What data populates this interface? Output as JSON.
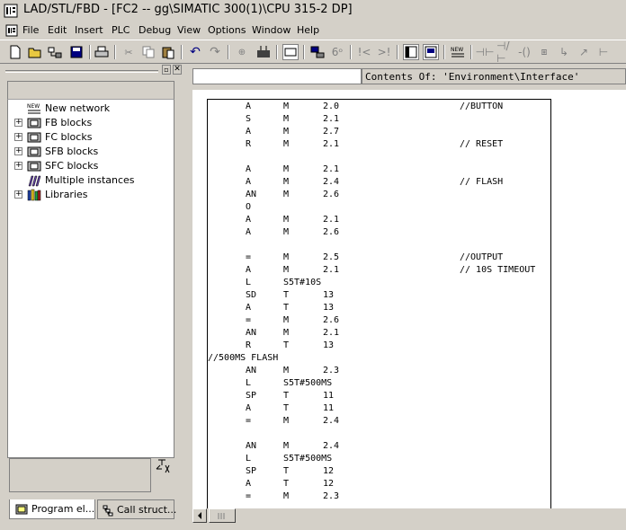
{
  "window": {
    "title": "LAD/STL/FBD  - [FC2 -- gg\\SIMATIC 300(1)\\CPU 315-2 DP]"
  },
  "menu": [
    "File",
    "Edit",
    "Insert",
    "PLC",
    "Debug",
    "View",
    "Options",
    "Window",
    "Help"
  ],
  "toolbar": {
    "icons": [
      "new-icon",
      "open-icon",
      "accessible-nodes-icon",
      "save-icon",
      "print-icon",
      "cut-icon",
      "copy-icon",
      "paste-icon",
      "undo-icon",
      "redo-icon",
      "download-icon",
      "upload-icon",
      "overview-icon",
      "monitor-icon",
      "network-icon",
      "glasses-icon",
      "open-branch-icon",
      "close-branch-icon",
      "program-elements-icon",
      "details-icon",
      "new-network-icon",
      "contact-no-icon",
      "contact-nc-icon",
      "coil-icon",
      "box-icon",
      "branch-down-icon",
      "branch-up-icon",
      "branch-close-icon"
    ]
  },
  "left_pane": {
    "tree": [
      {
        "label": "New network",
        "icon": "new-network-icon",
        "expandable": false
      },
      {
        "label": "FB blocks",
        "icon": "fb-blocks-icon",
        "expandable": true
      },
      {
        "label": "FC blocks",
        "icon": "fc-blocks-icon",
        "expandable": true
      },
      {
        "label": "SFB blocks",
        "icon": "sfb-blocks-icon",
        "expandable": true
      },
      {
        "label": "SFC blocks",
        "icon": "sfc-blocks-icon",
        "expandable": true
      },
      {
        "label": "Multiple instances",
        "icon": "multiple-instances-icon",
        "expandable": false
      },
      {
        "label": "Libraries",
        "icon": "libraries-icon",
        "expandable": true
      }
    ],
    "tabs": {
      "program_elements": "Program el...",
      "call_structure": "Call struct..."
    }
  },
  "right_pane": {
    "contents_label": "Contents Of: 'Environment\\Interface'",
    "code": [
      {
        "op": "A",
        "area": "M",
        "val": "2.0",
        "cmt": "//BUTTON"
      },
      {
        "op": "S",
        "area": "M",
        "val": "2.1",
        "cmt": ""
      },
      {
        "op": "A",
        "area": "M",
        "val": "2.7",
        "cmt": ""
      },
      {
        "op": "R",
        "area": "M",
        "val": "2.1",
        "cmt": "// RESET"
      },
      {
        "op": "",
        "area": "",
        "val": "",
        "cmt": ""
      },
      {
        "op": "A",
        "area": "M",
        "val": "2.1",
        "cmt": ""
      },
      {
        "op": "A",
        "area": "M",
        "val": "2.4",
        "cmt": "// FLASH"
      },
      {
        "op": "AN",
        "area": "M",
        "val": "2.6",
        "cmt": ""
      },
      {
        "op": "O",
        "area": "",
        "val": "",
        "cmt": ""
      },
      {
        "op": "A",
        "area": "M",
        "val": "2.1",
        "cmt": ""
      },
      {
        "op": "A",
        "area": "M",
        "val": "2.6",
        "cmt": ""
      },
      {
        "op": "",
        "area": "",
        "val": "",
        "cmt": ""
      },
      {
        "op": "=",
        "area": "M",
        "val": "2.5",
        "cmt": "//OUTPUT"
      },
      {
        "op": "A",
        "area": "M",
        "val": "2.1",
        "cmt": "// 10S TIMEOUT"
      },
      {
        "op": "L",
        "area": "S5T#10S",
        "val": "",
        "cmt": ""
      },
      {
        "op": "SD",
        "area": "T",
        "val": "13",
        "cmt": ""
      },
      {
        "op": "A",
        "area": "T",
        "val": "13",
        "cmt": ""
      },
      {
        "op": "=",
        "area": "M",
        "val": "2.6",
        "cmt": ""
      },
      {
        "op": "AN",
        "area": "M",
        "val": "2.1",
        "cmt": ""
      },
      {
        "op": "R",
        "area": "T",
        "val": "13",
        "cmt": ""
      },
      {
        "free": "//500MS FLASH"
      },
      {
        "op": "AN",
        "area": "M",
        "val": "2.3",
        "cmt": ""
      },
      {
        "op": "L",
        "area": "S5T#500MS",
        "val": "",
        "cmt": ""
      },
      {
        "op": "SP",
        "area": "T",
        "val": "11",
        "cmt": ""
      },
      {
        "op": "A",
        "area": "T",
        "val": "11",
        "cmt": ""
      },
      {
        "op": "=",
        "area": "M",
        "val": "2.4",
        "cmt": ""
      },
      {
        "op": "",
        "area": "",
        "val": "",
        "cmt": ""
      },
      {
        "op": "AN",
        "area": "M",
        "val": "2.4",
        "cmt": ""
      },
      {
        "op": "L",
        "area": "S5T#500MS",
        "val": "",
        "cmt": ""
      },
      {
        "op": "SP",
        "area": "T",
        "val": "12",
        "cmt": ""
      },
      {
        "op": "A",
        "area": "T",
        "val": "12",
        "cmt": ""
      },
      {
        "op": "=",
        "area": "M",
        "val": "2.3",
        "cmt": ""
      }
    ]
  },
  "colors": {
    "window_bg": "#d4d0c8",
    "editor_bg": "#ffffff"
  }
}
